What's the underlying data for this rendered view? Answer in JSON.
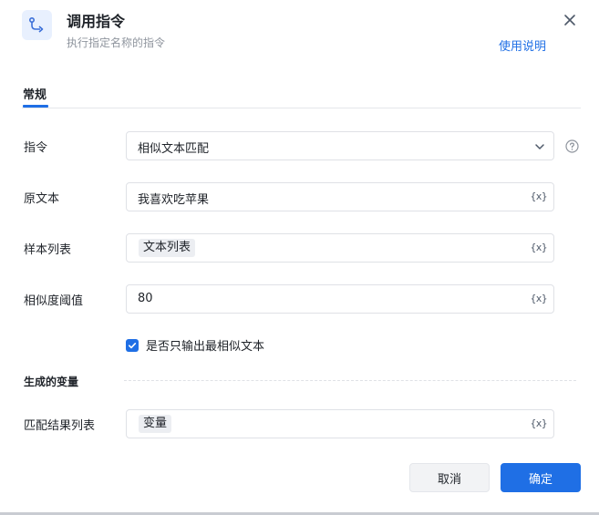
{
  "header": {
    "title": "调用指令",
    "subtitle": "执行指定名称的指令",
    "help_link": "使用说明",
    "icon": "branch-flow-icon",
    "close_icon": "close-icon"
  },
  "tabs": [
    {
      "label": "常规",
      "active": true
    }
  ],
  "form": {
    "command": {
      "label": "指令",
      "value": "相似文本匹配",
      "icon": "chevron-down-icon"
    },
    "source_text": {
      "label": "原文本",
      "value": "我喜欢吃苹果",
      "var_button": "{x}"
    },
    "sample_list": {
      "label": "样本列表",
      "tag": "文本列表",
      "var_button": "{x}"
    },
    "threshold": {
      "label": "相似度阈值",
      "value": "80",
      "var_button": "{x}"
    },
    "only_best": {
      "label": "是否只输出最相似文本",
      "checked": true
    }
  },
  "output_section": {
    "title": "生成的变量",
    "match_list": {
      "label": "匹配结果列表",
      "tag": "变量",
      "var_button": "{x}"
    }
  },
  "buttons": {
    "cancel": "取消",
    "ok": "确定"
  },
  "colors": {
    "accent": "#1f6fe5",
    "border": "#dfe1e6",
    "tag_bg": "#eceef2"
  }
}
